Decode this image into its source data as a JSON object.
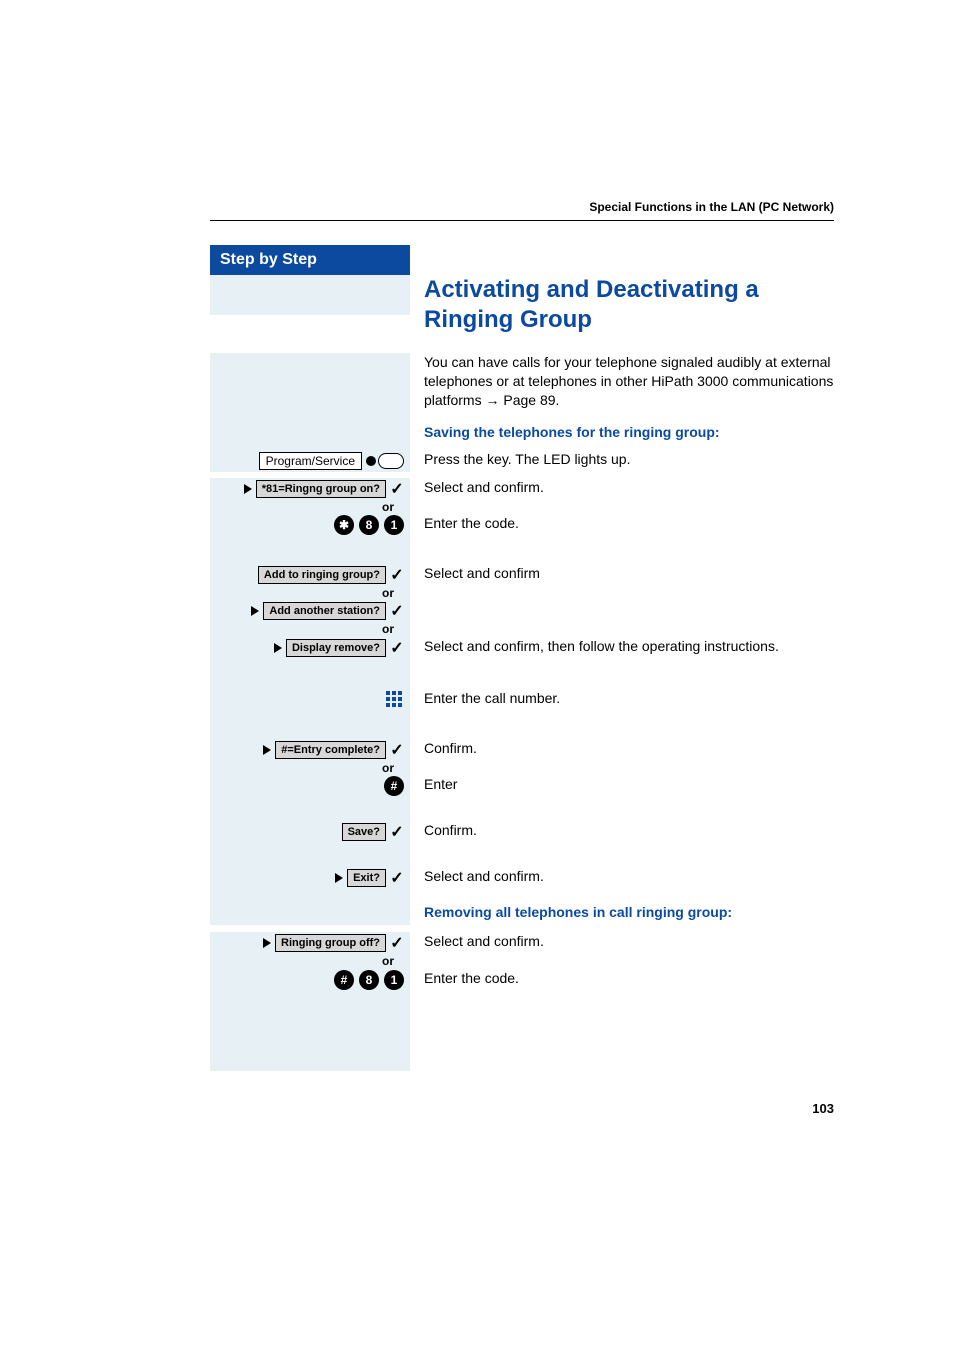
{
  "header": "Special Functions in the LAN (PC Network)",
  "stepByStep": "Step by Step",
  "title": "Activating and Deactivating a Ringing Group",
  "intro": "You can have calls for your telephone signaled audibly at external telephones or at telephones in other HiPath 3000 communications platforms → Page 89.",
  "subheading1": "Saving the telephones for the ringing group:",
  "subheading2": "Removing all telephones in call ringing group:",
  "steps": {
    "programService": {
      "label": "Program/Service",
      "desc": "Press the key. The LED lights up."
    },
    "ringOn": {
      "label": "*81=Ringng group on?",
      "desc": "Select and confirm."
    },
    "code1": {
      "keys": [
        "✱",
        "8",
        "1"
      ],
      "desc": "Enter the code."
    },
    "addTo": {
      "label": "Add to ringing group?",
      "desc": "Select and confirm"
    },
    "addAnother": {
      "label": "Add another station?"
    },
    "displayRemove": {
      "label": "Display remove?",
      "desc": "Select and confirm, then follow the operating instructions."
    },
    "enterCallNum": {
      "desc": "Enter the call number."
    },
    "entryComplete": {
      "label": "#=Entry complete?",
      "desc": "Confirm."
    },
    "enterHash": {
      "key": "#",
      "desc": "Enter"
    },
    "save": {
      "label": "Save?",
      "desc": "Confirm."
    },
    "exit": {
      "label": "Exit?",
      "desc": "Select and confirm."
    },
    "ringOff": {
      "label": "Ringing group off?",
      "desc": "Select and confirm."
    },
    "code2": {
      "keys": [
        "#",
        "8",
        "1"
      ],
      "desc": "Enter the code."
    }
  },
  "or": "or",
  "pageNumber": "103"
}
